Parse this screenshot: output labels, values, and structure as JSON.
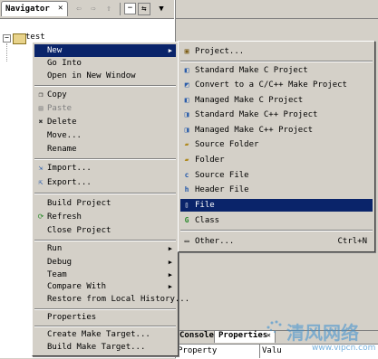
{
  "navigator": {
    "title": "Navigator",
    "close_glyph": "✕",
    "tree_item": "test"
  },
  "context_menu": {
    "items": [
      {
        "label": "New",
        "icon": "none",
        "submenu": true,
        "selected": true
      },
      {
        "label": "Go Into",
        "icon": "none"
      },
      {
        "label": "Open in New Window",
        "icon": "none"
      },
      {
        "label": "Copy",
        "icon": "copy-icon"
      },
      {
        "label": "Paste",
        "icon": "paste-icon",
        "disabled": true
      },
      {
        "label": "Delete",
        "icon": "delete-icon"
      },
      {
        "label": "Move...",
        "icon": "none"
      },
      {
        "label": "Rename",
        "icon": "none"
      },
      {
        "label": "Import...",
        "icon": "import-icon"
      },
      {
        "label": "Export...",
        "icon": "export-icon"
      },
      {
        "label": "Build Project",
        "icon": "none"
      },
      {
        "label": "Refresh",
        "icon": "refresh-icon"
      },
      {
        "label": "Close Project",
        "icon": "none"
      },
      {
        "label": "Run",
        "icon": "none",
        "submenu": true
      },
      {
        "label": "Debug",
        "icon": "none",
        "submenu": true
      },
      {
        "label": "Team",
        "icon": "none",
        "submenu": true
      },
      {
        "label": "Compare With",
        "icon": "none",
        "submenu": true
      },
      {
        "label": "Restore from Local History...",
        "icon": "none"
      },
      {
        "label": "Properties",
        "icon": "none"
      },
      {
        "label": "Create Make Target...",
        "icon": "none"
      },
      {
        "label": "Build Make Target...",
        "icon": "none"
      }
    ]
  },
  "new_menu": {
    "items": [
      {
        "label": "Project...",
        "icon": "project-icon"
      },
      {
        "label": "Standard Make C Project",
        "icon": "c-project-icon"
      },
      {
        "label": "Convert to a C/C++ Make Project",
        "icon": "convert-icon"
      },
      {
        "label": "Managed Make C Project",
        "icon": "c-project-icon"
      },
      {
        "label": "Standard Make C++ Project",
        "icon": "cpp-project-icon"
      },
      {
        "label": "Managed Make C++ Project",
        "icon": "cpp-project-icon"
      },
      {
        "label": "Source Folder",
        "icon": "source-folder-icon"
      },
      {
        "label": "Folder",
        "icon": "folder-icon"
      },
      {
        "label": "Source File",
        "icon": "source-file-icon"
      },
      {
        "label": "Header File",
        "icon": "header-file-icon"
      },
      {
        "label": "File",
        "icon": "file-icon",
        "selected": true
      },
      {
        "label": "Class",
        "icon": "class-icon"
      },
      {
        "label": "Other...",
        "icon": "other-icon",
        "accelerator": "Ctrl+N"
      }
    ]
  },
  "bottom_panel": {
    "tab_console": "Console",
    "tab_properties": "Properties",
    "tab_close": "✕",
    "col_property": "Property",
    "col_value": "Valu"
  },
  "watermark": {
    "text": "清风网络",
    "url": "www.vipcn.com"
  }
}
